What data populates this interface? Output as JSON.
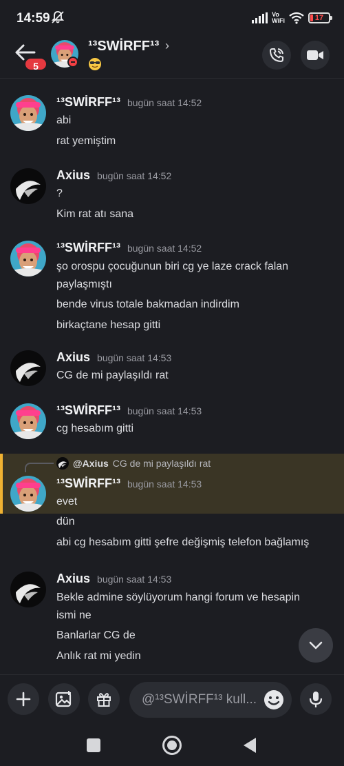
{
  "status_bar": {
    "time": "14:59",
    "network_label": "Vo\nWiFi",
    "battery_level": "17"
  },
  "header": {
    "unread_count": "5",
    "name": "¹³SWİRFF¹³",
    "chevron": "›"
  },
  "messages": [
    {
      "author": "¹³SWİRFF¹³",
      "avatar": "swirff",
      "timestamp": "bugün saat 14:52",
      "lines": [
        "abi",
        "rat yemiştim"
      ]
    },
    {
      "author": "Axius",
      "avatar": "axius",
      "timestamp": "bugün saat 14:52",
      "lines": [
        "?",
        "Kim rat atı sana"
      ]
    },
    {
      "author": "¹³SWİRFF¹³",
      "avatar": "swirff",
      "timestamp": "bugün saat 14:52",
      "lines": [
        "şo orospu çocuğunun biri cg ye laze crack falan",
        "paylaşmıştı",
        "bende virus totale bakmadan indirdim",
        "birkaçtane hesap gitti"
      ]
    },
    {
      "author": "Axius",
      "avatar": "axius",
      "timestamp": "bugün saat 14:53",
      "lines": [
        "CG de mi paylaşıldı rat"
      ]
    },
    {
      "author": "¹³SWİRFF¹³",
      "avatar": "swirff",
      "timestamp": "bugün saat 14:53",
      "lines": [
        "cg hesabım gitti"
      ]
    },
    {
      "author": "¹³SWİRFF¹³",
      "avatar": "swirff",
      "timestamp": "bugün saat 14:53",
      "reply": {
        "to": "@Axius",
        "text": "CG de mi paylaşıldı rat"
      },
      "lines": [
        "evet",
        "dün",
        "abi cg hesabım gitti şefre değişmiş telefon bağlamış"
      ]
    },
    {
      "author": "Axius",
      "avatar": "axius",
      "timestamp": "bugün saat 14:53",
      "lines": [
        "Bekle admine söylüyorum hangi forum ve hesapin",
        "ismi ne",
        "Banlarlar CG de",
        "Anlık rat mi yedin"
      ]
    }
  ],
  "composer": {
    "placeholder": "@¹³SWİRFF¹³ kull..."
  },
  "colors": {
    "background": "#1c1d22",
    "reply_highlight": "#3a3525",
    "reply_accent": "#f0b232",
    "badge_red": "#e53940",
    "dnd_red": "#f23f43"
  }
}
